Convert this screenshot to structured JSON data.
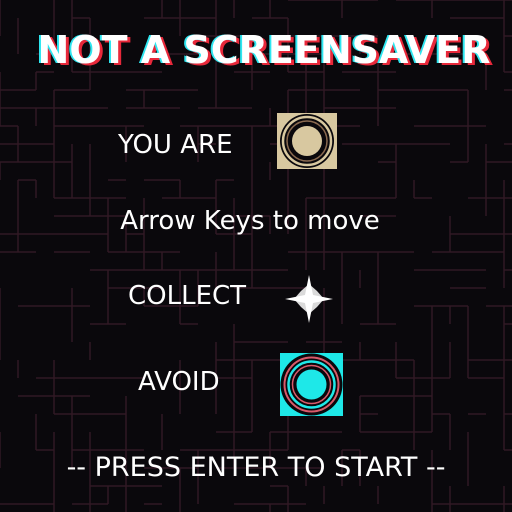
{
  "game": {
    "title": "NOT A SCREENSAVER",
    "you_are": "YOU ARE",
    "controls": "Arrow Keys to move",
    "collect": "COLLECT",
    "avoid": "AVOID",
    "start_prompt": "-- PRESS ENTER TO START --"
  },
  "icons": {
    "player": "player-ring-icon",
    "collectible": "four-point-star-icon",
    "enemy": "cyan-target-icon"
  },
  "colors": {
    "background": "#0a080c",
    "maze_lines": "#3a1e2a",
    "title_cyan": "#2ee6f0",
    "title_red": "#e8283a",
    "player_tan": "#d8c8a0",
    "enemy_cyan": "#1ee8e8",
    "enemy_ring": "#d85a6a"
  }
}
